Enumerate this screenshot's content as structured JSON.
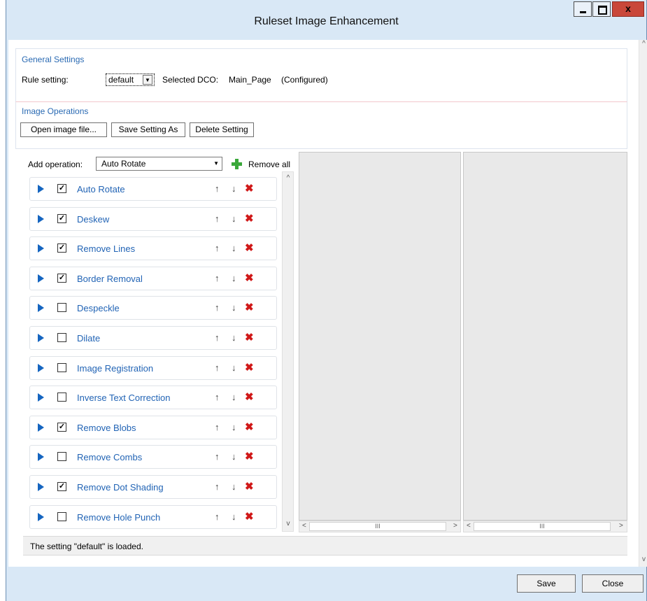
{
  "window": {
    "title": "Ruleset Image Enhancement",
    "close_glyph": "x"
  },
  "general": {
    "section_title": "General Settings",
    "rule_setting_label": "Rule setting:",
    "rule_setting_value": "default",
    "selected_dco_label": "Selected DCO:",
    "selected_dco_value": "Main_Page",
    "selected_dco_status": "(Configured)"
  },
  "image_operations": {
    "section_title": "Image Operations",
    "open_button": "Open image file...",
    "save_as_button": "Save Setting As",
    "delete_button": "Delete Setting"
  },
  "operations": {
    "add_label": "Add operation:",
    "selected_operation": "Auto Rotate",
    "remove_all": "Remove all",
    "items": [
      {
        "name": "Auto Rotate",
        "checked": true,
        "check_glyph": "✓"
      },
      {
        "name": "Deskew",
        "checked": true,
        "check_glyph": "✓"
      },
      {
        "name": "Remove Lines",
        "checked": true,
        "check_glyph": "✓"
      },
      {
        "name": "Border Removal",
        "checked": true,
        "check_glyph": "✓"
      },
      {
        "name": "Despeckle",
        "checked": false,
        "check_glyph": ""
      },
      {
        "name": "Dilate",
        "checked": false,
        "check_glyph": ""
      },
      {
        "name": "Image Registration",
        "checked": false,
        "check_glyph": ""
      },
      {
        "name": "Inverse Text Correction",
        "checked": false,
        "check_glyph": ""
      },
      {
        "name": "Remove Blobs",
        "checked": true,
        "check_glyph": "✓"
      },
      {
        "name": "Remove Combs",
        "checked": false,
        "check_glyph": ""
      },
      {
        "name": "Remove Dot Shading",
        "checked": true,
        "check_glyph": "✓"
      },
      {
        "name": "Remove Hole Punch",
        "checked": false,
        "check_glyph": ""
      }
    ],
    "move_up_glyph": "↑",
    "move_down_glyph": "↓",
    "delete_glyph": "✖"
  },
  "scroll": {
    "thumb_glyph": "III",
    "left_glyph": "<",
    "right_glyph": ">",
    "up_glyph": "^",
    "down_glyph": "v"
  },
  "status": {
    "message": "The setting \"default\" is loaded."
  },
  "footer": {
    "save_button": "Save",
    "close_button": "Close"
  },
  "colors": {
    "accent_blue": "#2264b5",
    "delete_red": "#d01818",
    "add_green": "#3aa83a",
    "window_frame": "#d9e8f6"
  }
}
